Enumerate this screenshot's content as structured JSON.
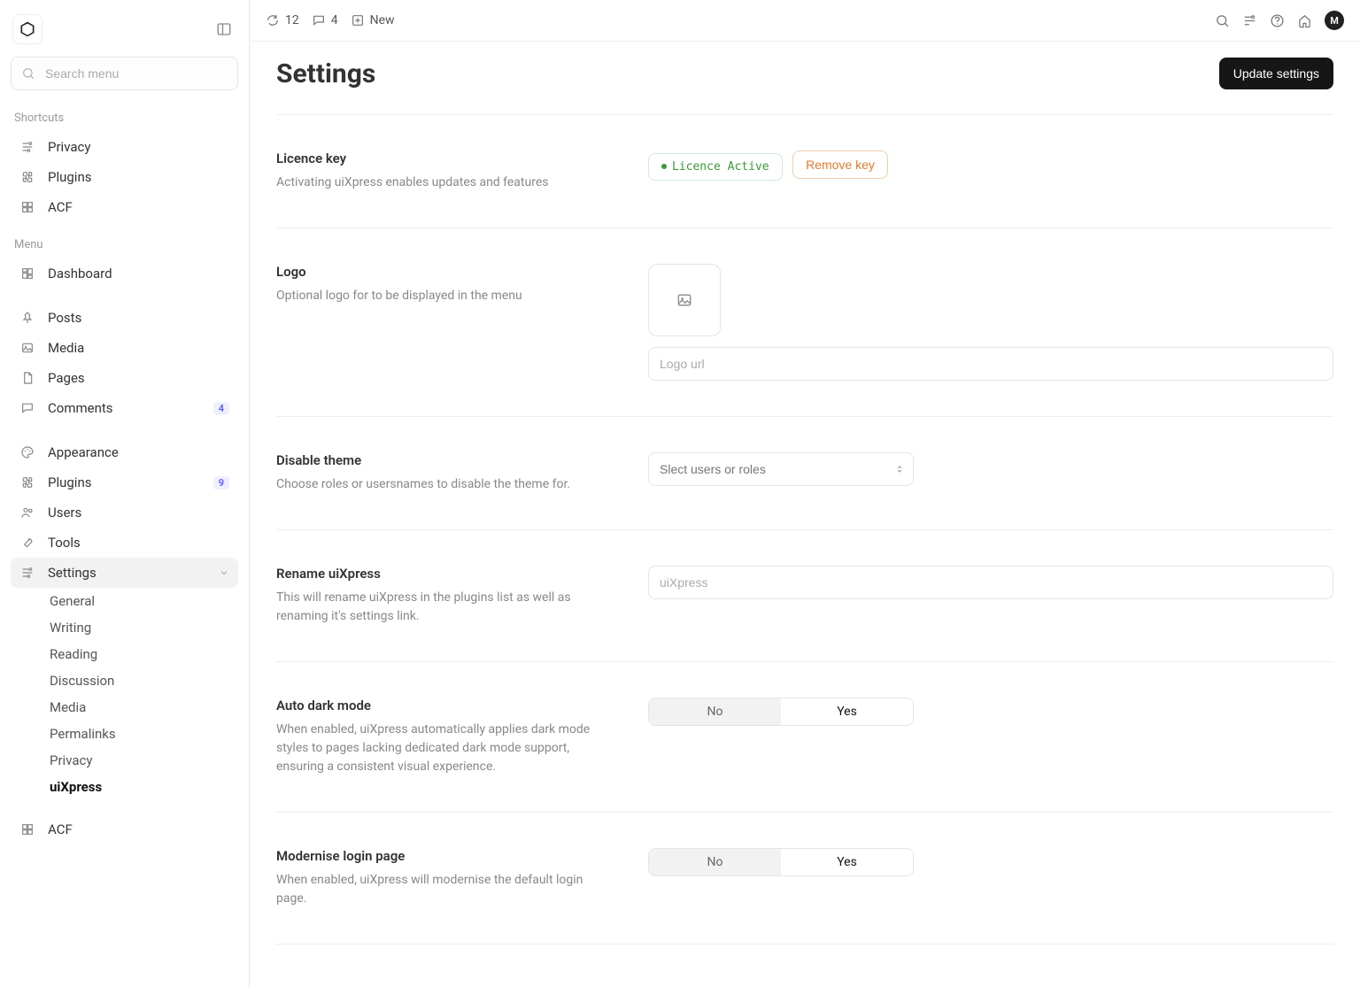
{
  "sidebar": {
    "search_placeholder": "Search menu",
    "section_shortcuts": "Shortcuts",
    "section_menu": "Menu",
    "shortcuts": [
      {
        "label": "Privacy",
        "icon": "sliders"
      },
      {
        "label": "Plugins",
        "icon": "puzzle"
      },
      {
        "label": "ACF",
        "icon": "grid"
      }
    ],
    "menu": [
      {
        "label": "Dashboard",
        "icon": "dashboard"
      },
      {
        "label": "Posts",
        "icon": "pin"
      },
      {
        "label": "Media",
        "icon": "image"
      },
      {
        "label": "Pages",
        "icon": "page"
      },
      {
        "label": "Comments",
        "icon": "chat",
        "badge": "4"
      },
      {
        "label": "Appearance",
        "icon": "palette"
      },
      {
        "label": "Plugins",
        "icon": "puzzle",
        "badge": "9"
      },
      {
        "label": "Users",
        "icon": "users"
      },
      {
        "label": "Tools",
        "icon": "wrench"
      },
      {
        "label": "Settings",
        "icon": "sliders",
        "active": true,
        "expanded": true
      },
      {
        "label": "ACF",
        "icon": "grid"
      }
    ],
    "settings_sub": [
      {
        "label": "General"
      },
      {
        "label": "Writing"
      },
      {
        "label": "Reading"
      },
      {
        "label": "Discussion"
      },
      {
        "label": "Media"
      },
      {
        "label": "Permalinks"
      },
      {
        "label": "Privacy"
      },
      {
        "label": "uiXpress",
        "active": true
      }
    ]
  },
  "topbar": {
    "count1": "12",
    "count2": "4",
    "new_label": "New",
    "avatar_initial": "M"
  },
  "page": {
    "title": "Settings",
    "update_button": "Update settings"
  },
  "settings": {
    "licence": {
      "title": "Licence key",
      "desc": "Activating uiXpress enables updates and features",
      "status": "Licence Active",
      "remove_label": "Remove key"
    },
    "logo": {
      "title": "Logo",
      "desc": "Optional logo for to be displayed in the menu",
      "url_placeholder": "Logo url"
    },
    "disable_theme": {
      "title": "Disable theme",
      "desc": "Choose roles or usersnames to disable the theme for.",
      "select_placeholder": "Slect users or roles"
    },
    "rename": {
      "title": "Rename uiXpress",
      "desc": "This will rename uiXpress in the plugins list as well as renaming it's settings link.",
      "placeholder": "uiXpress"
    },
    "auto_dark": {
      "title": "Auto dark mode",
      "desc": "When enabled, uiXpress automatically applies dark mode styles to pages lacking dedicated dark mode support, ensuring a consistent visual experience.",
      "no": "No",
      "yes": "Yes"
    },
    "modernise": {
      "title": "Modernise login page",
      "desc": "When enabled, uiXpress will modernise the default login page.",
      "no": "No",
      "yes": "Yes"
    }
  }
}
